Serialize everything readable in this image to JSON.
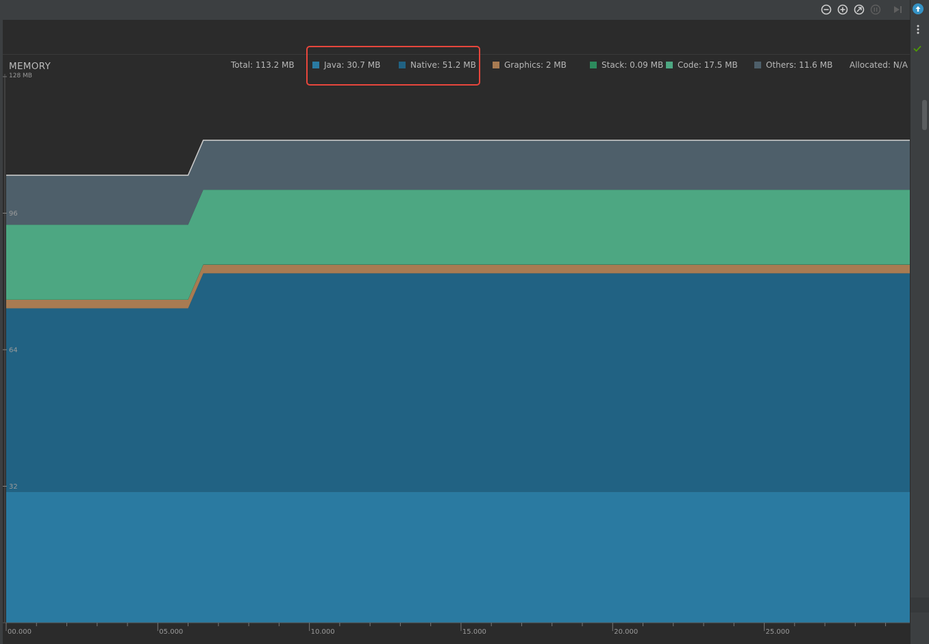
{
  "toolbar": {
    "icons": [
      "zoom-out-icon",
      "zoom-in-icon",
      "reset-zoom-icon",
      "pause-icon",
      "go-to-live-icon"
    ]
  },
  "side_strip": {
    "icons": [
      "update-icon",
      "more-options-icon",
      "check-icon"
    ],
    "colors": {
      "update": "#3592c4",
      "check": "#4e9a06"
    }
  },
  "memory": {
    "title": "MEMORY",
    "max_label": "128 MB"
  },
  "legend": {
    "total": "Total: 113.2 MB",
    "java": "Java: 30.7 MB",
    "native": "Native: 51.2 MB",
    "graphics": "Graphics: 2 MB",
    "stack": "Stack: 0.09 MB",
    "code": "Code: 17.5 MB",
    "others": "Others: 11.6 MB",
    "allocated": "Allocated: N/A"
  },
  "highlight_color": "#e8463c",
  "colors": {
    "java": "#2a7aa1",
    "native": "#216283",
    "graphics": "#a87b52",
    "stack": "#2d8a5d",
    "code": "#4da782",
    "others": "#4e5f6a",
    "total_line": "#c8c8c8"
  },
  "chart_data": {
    "type": "area",
    "stacked": true,
    "title": "MEMORY",
    "ylabel": "128 MB",
    "yticks": [
      "96",
      "64",
      "32"
    ],
    "ytick_values": [
      96,
      64,
      32
    ],
    "ylim": [
      0,
      128
    ],
    "xlim": [
      0,
      29.8
    ],
    "xticks": [
      "00.000",
      "05.000",
      "10.000",
      "15.000",
      "20.000",
      "25.000"
    ],
    "xtick_values": [
      0,
      5,
      10,
      15,
      20,
      25
    ],
    "x": [
      0,
      6,
      6.5,
      29.8
    ],
    "series": [
      {
        "name": "Java",
        "color": "#2a7aa1",
        "values": [
          30.7,
          30.7,
          30.7,
          30.7
        ]
      },
      {
        "name": "Native",
        "color": "#216283",
        "values": [
          43,
          43,
          51.2,
          51.2
        ]
      },
      {
        "name": "Graphics",
        "color": "#a87b52",
        "values": [
          2,
          2,
          2,
          2
        ]
      },
      {
        "name": "Stack",
        "color": "#2d8a5d",
        "values": [
          0.09,
          0.09,
          0.09,
          0.09
        ]
      },
      {
        "name": "Code",
        "color": "#4da782",
        "values": [
          17.5,
          17.5,
          17.5,
          17.5
        ]
      },
      {
        "name": "Others",
        "color": "#4e5f6a",
        "values": [
          11.6,
          11.6,
          11.6,
          11.6
        ]
      }
    ]
  }
}
